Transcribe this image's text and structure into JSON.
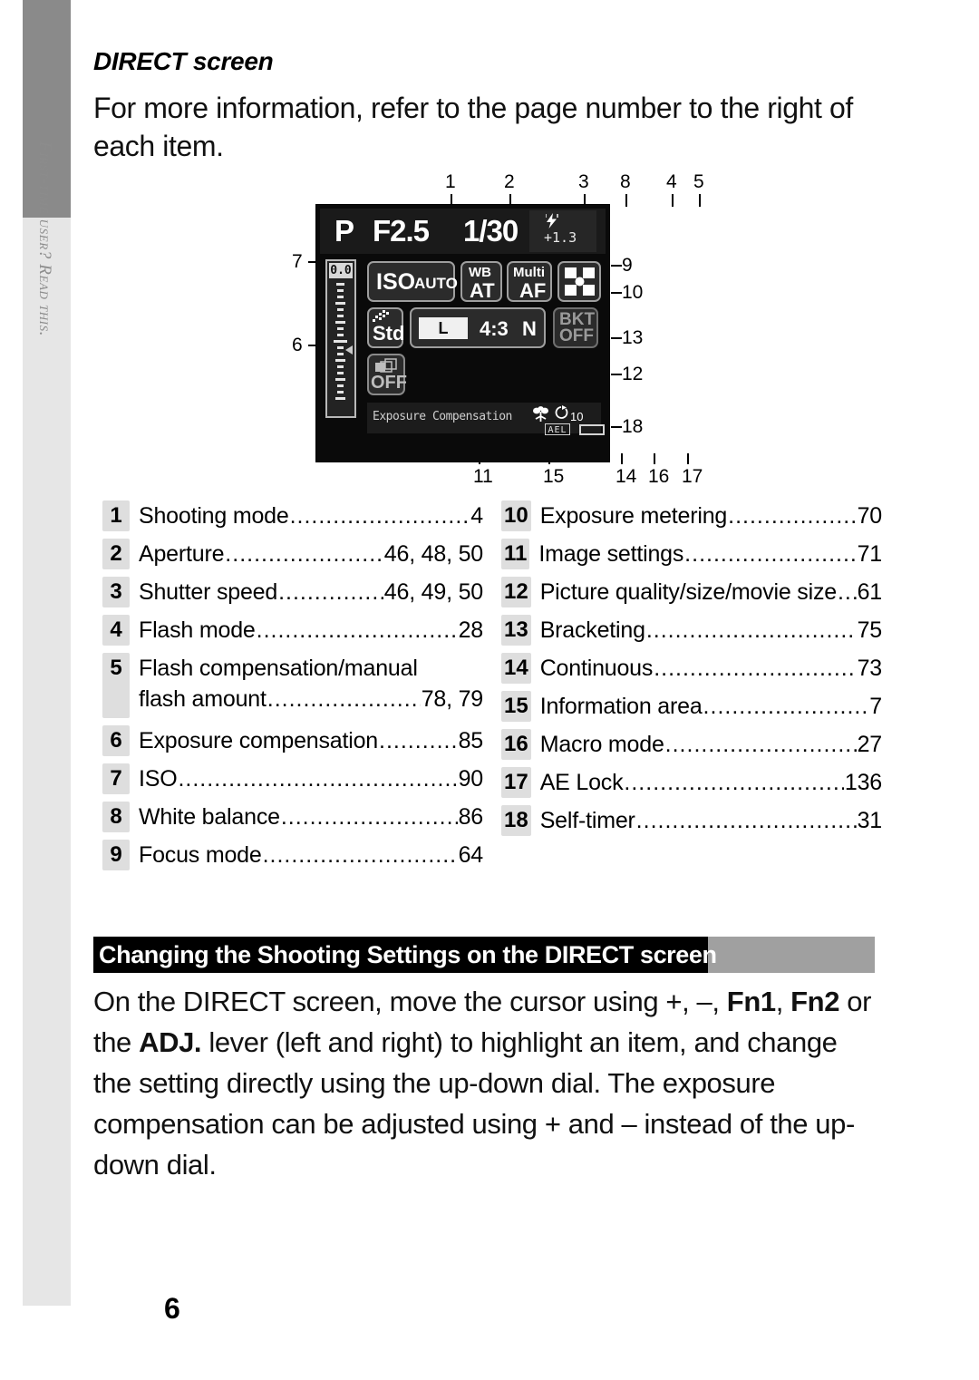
{
  "sidebar": {
    "tab_label": "First-time user? Read this."
  },
  "page": {
    "number": "6",
    "subtitle": "DIRECT screen",
    "intro": "For more information, refer to the page number to the right of each item."
  },
  "figure": {
    "lcd": {
      "shooting_mode": "P",
      "aperture": "F2.5",
      "shutter_speed": "1/30",
      "flash_icon": "flash-bolt-icon",
      "flash_compensation": "+1.3",
      "exposure_compensation_value": "0.0",
      "iso_label": "ISO",
      "iso_value": "AUTO",
      "wb_top": "WB",
      "wb_bottom": "AT",
      "af_top": "Multi",
      "af_bottom": "AF",
      "metering_icon": "multi-metering-icon",
      "image_settings": "Std",
      "picture_size": "L",
      "aspect_ratio": "4:3",
      "quality_level": "N",
      "bracketing_top": "BKT",
      "bracketing_bottom": "OFF",
      "continuous_icon": "continuous-frames-icon",
      "continuous_label": "OFF",
      "information_area_text": "Exposure Compensation",
      "macro_icon": "macro-flower-icon",
      "self_timer_icon": "self-timer-icon",
      "self_timer_count": "10",
      "ae_lock_badge": "AEL",
      "battery_icon": "battery-icon"
    },
    "callouts_top": [
      "1",
      "2",
      "3",
      "8",
      "4",
      "5"
    ],
    "callouts_left": [
      "7",
      "6"
    ],
    "callouts_right": [
      "9",
      "10",
      "13",
      "12",
      "18"
    ],
    "callouts_bottom": [
      "11",
      "15",
      "14",
      "16",
      "17"
    ]
  },
  "index": {
    "left_column": [
      {
        "num": "1",
        "label": "Shooting mode",
        "page": "4"
      },
      {
        "num": "2",
        "label": "Aperture",
        "page": "46, 48, 50"
      },
      {
        "num": "3",
        "label": "Shutter speed",
        "page": "46, 49, 50"
      },
      {
        "num": "4",
        "label": "Flash mode",
        "page": "28"
      },
      {
        "num": "5",
        "label": "Flash compensation/manual",
        "label2": "flash amount",
        "page": "78, 79",
        "two_line": true
      },
      {
        "num": "6",
        "label": "Exposure compensation",
        "page": "85"
      },
      {
        "num": "7",
        "label": "ISO",
        "page": "90"
      },
      {
        "num": "8",
        "label": "White balance",
        "page": "86"
      },
      {
        "num": "9",
        "label": "Focus mode",
        "page": "64"
      }
    ],
    "right_column": [
      {
        "num": "10",
        "label": "Exposure metering",
        "page": "70"
      },
      {
        "num": "11",
        "label": "Image settings",
        "page": "71"
      },
      {
        "num": "12",
        "label": "Picture quality/size/movie size",
        "page": "61"
      },
      {
        "num": "13",
        "label": "Bracketing",
        "page": "75"
      },
      {
        "num": "14",
        "label": "Continuous",
        "page": "73"
      },
      {
        "num": "15",
        "label": "Information area",
        "page": "7"
      },
      {
        "num": "16",
        "label": "Macro mode",
        "page": "27"
      },
      {
        "num": "17",
        "label": "AE Lock",
        "page": "136"
      },
      {
        "num": "18",
        "label": "Self-timer",
        "page": "31"
      }
    ]
  },
  "section": {
    "heading": "Changing the Shooting Settings on the DIRECT screen",
    "body_parts": [
      {
        "text": "On the DIRECT screen, move the cursor using +, –, ",
        "bold": false
      },
      {
        "text": "Fn1",
        "bold": true
      },
      {
        "text": ", ",
        "bold": false
      },
      {
        "text": "Fn2",
        "bold": true
      },
      {
        "text": " or the ",
        "bold": false
      },
      {
        "text": "ADJ.",
        "bold": true
      },
      {
        "text": " lever (left and right) to highlight an item, and change the setting directly using the up-down dial. The exposure compensation can be adjusted using + and – instead of the up-down dial.",
        "bold": false
      }
    ]
  },
  "colors": {
    "sidebar_dark": "#8a8a8a",
    "sidebar_light": "#e6e6e6",
    "heading_bar": "#a0a0a0",
    "heading_black": "#000000",
    "badge_gray": "#dedede"
  }
}
